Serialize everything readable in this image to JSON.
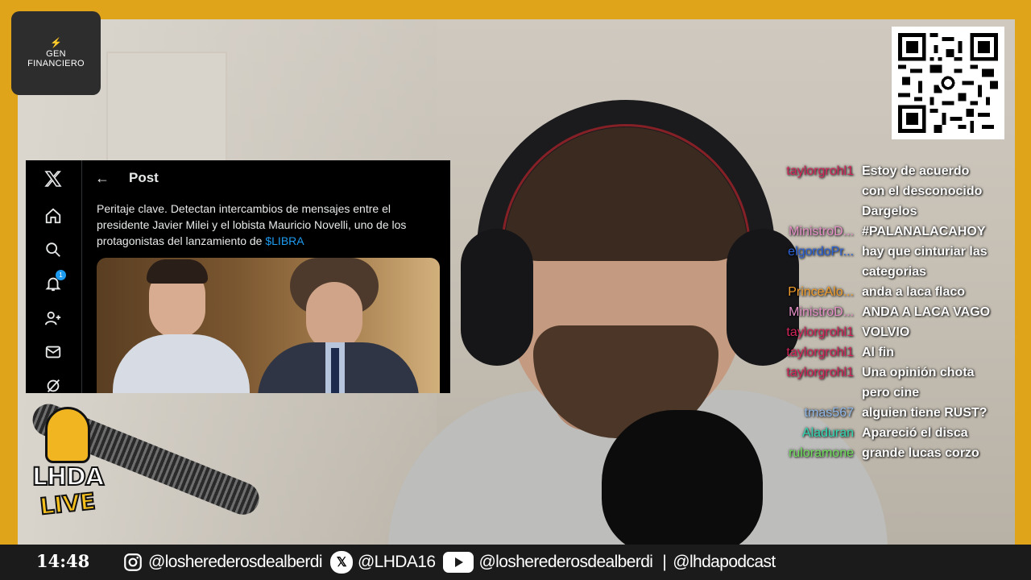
{
  "brand": {
    "line1": "GEN",
    "line2": "FINANCIERO",
    "mark": "⚡"
  },
  "x_post": {
    "header_title": "Post",
    "text_main": "Peritaje clave. Detectan intercambios de mensajes entre el presidente Javier Milei y el lobista Mauricio Novelli, uno de los protagonistas del lanzamiento de ",
    "text_tag": "$LIBRA",
    "notification_count": "1",
    "nav_icons": [
      "x-logo-icon",
      "home-icon",
      "search-icon",
      "bell-icon",
      "people-icon",
      "mail-icon",
      "grok-icon"
    ]
  },
  "chat": [
    {
      "user": "taylorgrohl1",
      "color": "#d2245a",
      "text": "Estoy de acuerdo con el desconocido Dargelos"
    },
    {
      "user": "MinistroD...",
      "color": "#e58fc6",
      "text": "#PALANALACAHOY"
    },
    {
      "user": "elgordoPr...",
      "color": "#2a62d8",
      "text": "hay que cinturiar las categorias"
    },
    {
      "user": "PrinceAlo...",
      "color": "#f19c2a",
      "text": "anda a laca flaco"
    },
    {
      "user": "MinistroD...",
      "color": "#e58fc6",
      "text": "ANDA A LACA VAGO"
    },
    {
      "user": "taylorgrohl1",
      "color": "#d2245a",
      "text": "VOLVIO"
    },
    {
      "user": "taylorgrohl1",
      "color": "#d2245a",
      "text": "Al fin"
    },
    {
      "user": "taylorgrohl1",
      "color": "#d2245a",
      "text": "Una opinión chota pero cine"
    },
    {
      "user": "tmas567",
      "color": "#8fb8e8",
      "text": "alguien tiene RUST?"
    },
    {
      "user": "Aladuran",
      "color": "#2fd8b2",
      "text": "Apareció el disca"
    },
    {
      "user": "ruloramone",
      "color": "#6ee05a",
      "text": "grande lucas corzo"
    }
  ],
  "show_logo": {
    "line1": "LHDA",
    "line2": "LIVE"
  },
  "bottom_bar": {
    "time": "14:48",
    "instagram": "@losherederosdealberdi",
    "x": "@LHDA16",
    "youtube": "@losherederosdealberdi",
    "separator": "|",
    "extra": "@lhdapodcast"
  },
  "colors": {
    "frame": "#e0a41a",
    "x_blue": "#1d9bf0",
    "bar": "#1b1b1b"
  }
}
